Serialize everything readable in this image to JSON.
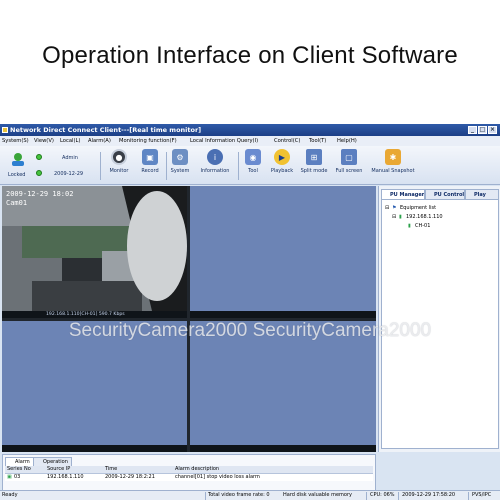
{
  "caption": "Operation Interface on Client Software",
  "window": {
    "title": "Network Direct Connect Client---[Real time monitor]",
    "buttons": [
      "_",
      "□",
      "×"
    ]
  },
  "menu": [
    "System(S)",
    "View(V)",
    "Local(L)",
    "Alarm(A)",
    "Monitoring function(F)",
    "Local Information Query(I)",
    "Control(C)",
    "Tool(T)",
    "Help(H)"
  ],
  "toolbar": {
    "status_label": "Locked",
    "user": "Admin",
    "date": "2009-12-29",
    "buttons": [
      {
        "label": "Monitor",
        "icon": "monitor-icon"
      },
      {
        "label": "Record",
        "icon": "record-icon"
      },
      {
        "label": "System",
        "icon": "system-icon"
      },
      {
        "label": "Information",
        "icon": "info-icon"
      },
      {
        "label": "Tool",
        "icon": "tool-icon"
      },
      {
        "label": "Playback",
        "icon": "playback-icon"
      },
      {
        "label": "Split mode",
        "icon": "split-mode-icon"
      },
      {
        "label": "Full screen",
        "icon": "fullscreen-icon"
      },
      {
        "label": "Manual Snapshot",
        "icon": "snapshot-icon"
      }
    ]
  },
  "video": {
    "osd_time": "2009-12-29 18:02",
    "osd_cam": "Cam01",
    "info_bar": "192.168.1.110[CH-01]   590.7 Kbps"
  },
  "side": {
    "tabs": [
      "PU Management",
      "PU Control",
      "Play"
    ],
    "tree": {
      "root": "Equipment list",
      "device": "192.168.1.110",
      "channel": "CH-01"
    }
  },
  "alarm": {
    "tabs": [
      "Alarm",
      "Operation"
    ],
    "columns": [
      "Series No",
      "Source IP",
      "Time",
      "Alarm description"
    ],
    "rows": [
      {
        "no": "03",
        "ip": "192.168.1.110",
        "time": "2009-12-29 18:2:21",
        "desc": "channel[01] stop video loss alarm"
      }
    ]
  },
  "status": {
    "left": "Ready",
    "frame": "Total video frame rate: 0",
    "disk": "Hard disk valuable memory",
    "cpu": "CPU: 06%",
    "datetime": "2009-12-29 17:58:20",
    "mode": "PVS/IPC"
  },
  "watermark": "SecurityCamera2000 SecurityCamera2000",
  "colors": {
    "titlebar": "#1c3f86",
    "empty_cell": "#6c84b5",
    "status_ok": "#46c33e"
  }
}
